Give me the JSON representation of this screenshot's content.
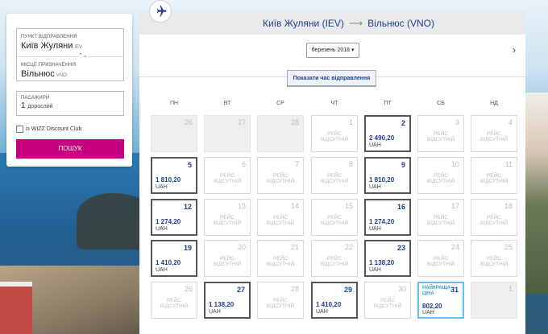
{
  "search": {
    "origin_label": "Пункт відправлення",
    "origin_value": "Київ Жуляни",
    "origin_code": "IEV",
    "destination_label": "Місце призначення",
    "destination_value": "Вільнюс",
    "destination_code": "VNO",
    "passengers_label": "Пасажири",
    "passengers_value": "1",
    "passengers_unit": "дорослий",
    "discount_label": "із WIZZ Discount Club",
    "search_button": "Пошук"
  },
  "calendar": {
    "route_from": "Київ Жуляни (IEV)",
    "route_to": "Вільнюс (VNO)",
    "month": "березень 2018",
    "show_times_button": "Показати час відправлення",
    "weekdays": [
      "ПН",
      "ВТ",
      "СР",
      "ЧТ",
      "ПТ",
      "СБ",
      "НД"
    ],
    "no_flight_label": "РЕЙС ВІДСУТНІЙ",
    "best_price_label": "НАЙКРАЩА ЦІНА",
    "currency": "UAH",
    "weeks": [
      [
        {
          "day": "26",
          "state": "out"
        },
        {
          "day": "27",
          "state": "out"
        },
        {
          "day": "28",
          "state": "out"
        },
        {
          "day": "1",
          "state": "none"
        },
        {
          "day": "2",
          "state": "flight",
          "price": "2 490,20"
        },
        {
          "day": "3",
          "state": "none"
        },
        {
          "day": "4",
          "state": "none"
        }
      ],
      [
        {
          "day": "5",
          "state": "flight",
          "price": "1 810,20"
        },
        {
          "day": "6",
          "state": "none"
        },
        {
          "day": "7",
          "state": "none"
        },
        {
          "day": "8",
          "state": "none"
        },
        {
          "day": "9",
          "state": "flight",
          "price": "1 810,20"
        },
        {
          "day": "10",
          "state": "none"
        },
        {
          "day": "11",
          "state": "none"
        }
      ],
      [
        {
          "day": "12",
          "state": "flight",
          "price": "1 274,20"
        },
        {
          "day": "13",
          "state": "none"
        },
        {
          "day": "14",
          "state": "none"
        },
        {
          "day": "15",
          "state": "none"
        },
        {
          "day": "16",
          "state": "flight",
          "price": "1 274,20"
        },
        {
          "day": "17",
          "state": "none"
        },
        {
          "day": "18",
          "state": "none"
        }
      ],
      [
        {
          "day": "19",
          "state": "flight",
          "price": "1 410,20"
        },
        {
          "day": "20",
          "state": "none"
        },
        {
          "day": "21",
          "state": "none"
        },
        {
          "day": "22",
          "state": "none"
        },
        {
          "day": "23",
          "state": "flight",
          "price": "1 138,20"
        },
        {
          "day": "24",
          "state": "none"
        },
        {
          "day": "25",
          "state": "none"
        }
      ],
      [
        {
          "day": "26",
          "state": "none"
        },
        {
          "day": "27",
          "state": "flight",
          "price": "1 138,20"
        },
        {
          "day": "28",
          "state": "none"
        },
        {
          "day": "29",
          "state": "flight",
          "price": "1 410,20"
        },
        {
          "day": "30",
          "state": "none"
        },
        {
          "day": "31",
          "state": "best",
          "price": "802,20"
        },
        {
          "day": "1",
          "state": "out"
        }
      ]
    ]
  },
  "colors": {
    "brand_pink": "#c6007e",
    "brand_navy": "#1b3f8c",
    "best_price_blue": "#5fc3f2"
  },
  "icons": {
    "plane": "plane-icon",
    "next": "chevron-right-icon",
    "dropdown": "caret-down-icon",
    "swap": "swap-icon"
  }
}
